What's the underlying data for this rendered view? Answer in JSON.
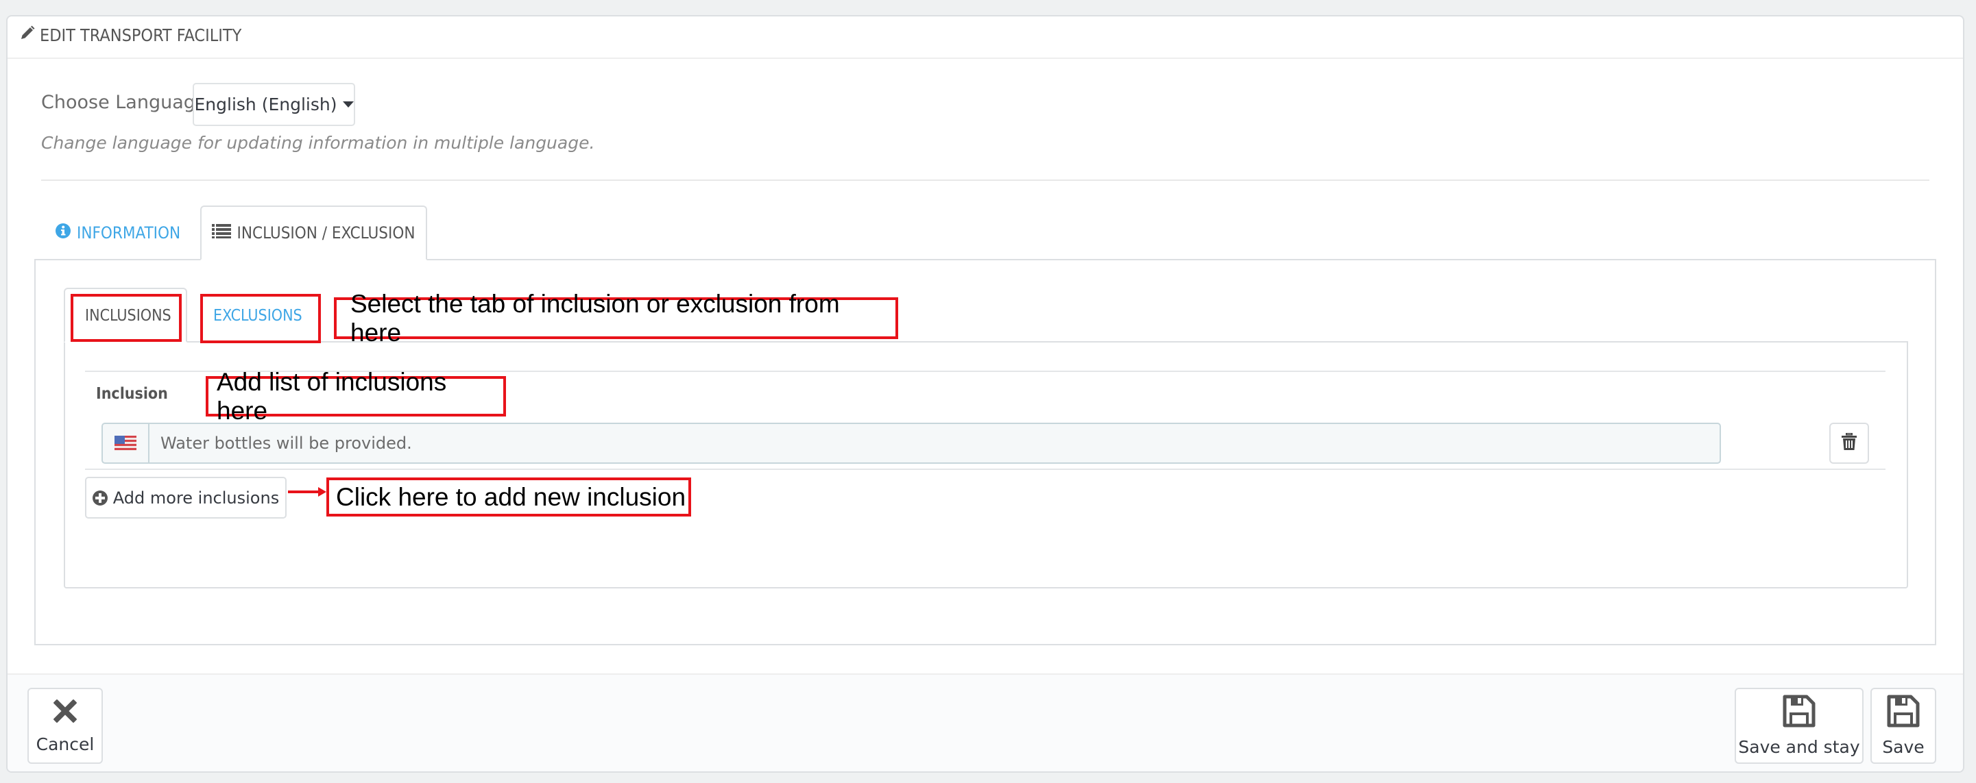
{
  "panel": {
    "title": "EDIT TRANSPORT FACILITY",
    "title_icon": "pencil-icon"
  },
  "language": {
    "label": "Choose Language",
    "selected": "English (English)",
    "help": "Change language for updating information in multiple language."
  },
  "tabs": [
    {
      "label": "INFORMATION",
      "icon": "info-circle-icon",
      "active": false
    },
    {
      "label": "INCLUSION / EXCLUSION",
      "icon": "list-icon",
      "active": true
    }
  ],
  "subtabs": [
    {
      "label": "INCLUSIONS",
      "active": true
    },
    {
      "label": "EXCLUSIONS",
      "active": false
    }
  ],
  "inclusion": {
    "label": "Inclusion",
    "items": [
      {
        "flag": "us-flag-icon",
        "value": "Water bottles will be provided."
      }
    ],
    "add_button": "Add more inclusions"
  },
  "annotations": {
    "subtabs": "Select the tab of inclusion or exclusion from here",
    "list": "Add list of inclusions here",
    "add": "Click here to add new inclusion"
  },
  "footer": {
    "cancel": "Cancel",
    "save_and_stay": "Save and stay",
    "save": "Save"
  },
  "colors": {
    "link": "#3ea6e6",
    "annotation": "#e8131a",
    "text": "#363a41"
  }
}
